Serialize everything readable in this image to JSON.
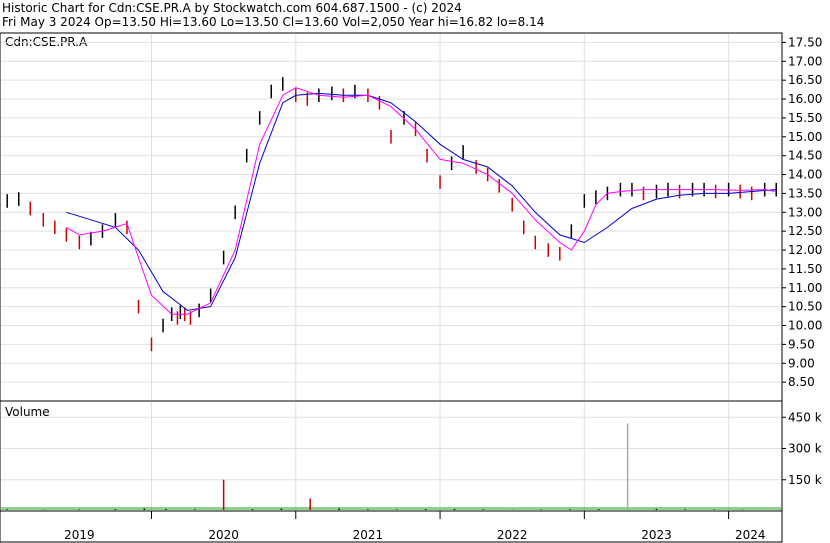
{
  "header": {
    "line1": "Historic Chart for Cdn:CSE.PR.A by Stockwatch.com 604.687.1500 - (c) 2024",
    "line2": "Fri May  3 2024   Op=13.50  Hi=13.60  Lo=13.50  Cl=13.60  Vol=2,050  Year hi=16.82  lo=8.14"
  },
  "colors": {
    "price": "#000000",
    "down_day": "#cc0000",
    "ma_short": "#ff00ff",
    "ma_long": "#0000cc",
    "volume": "#000000",
    "volume_up": "#009900",
    "volume_down": "#cc0000",
    "volume_spike": "#aaaaaa",
    "grid": "#e0e0e0",
    "panel_border": "#000000"
  },
  "chart_data": [
    {
      "type": "line",
      "title": "Cdn:CSE.PR.A",
      "ylim": [
        8.0,
        17.75
      ],
      "y_ticks": [
        "17.50",
        "17.00",
        "16.50",
        "16.00",
        "15.50",
        "15.00",
        "14.50",
        "14.00",
        "13.50",
        "13.00",
        "12.50",
        "12.00",
        "11.50",
        "11.00",
        "10.50",
        "10.00",
        "9.50",
        "9.00",
        "8.50"
      ],
      "xlim": [
        2018.95,
        2024.37
      ],
      "x_ticks": [
        "2019",
        "2020",
        "2021",
        "2022",
        "2023",
        "2024"
      ],
      "x_tick_pos": [
        2019.5,
        2020.5,
        2021.5,
        2022.5,
        2023.5,
        2024.15
      ],
      "grid": true,
      "series": [
        {
          "style": "daily-bars",
          "x": [
            2019.0,
            2019.08,
            2019.16,
            2019.25,
            2019.33,
            2019.41,
            2019.5,
            2019.58,
            2019.66,
            2019.75,
            2019.83,
            2019.91,
            2020.0,
            2020.08,
            2020.14,
            2020.18,
            2020.2,
            2020.23,
            2020.27,
            2020.33,
            2020.41,
            2020.5,
            2020.58,
            2020.66,
            2020.75,
            2020.83,
            2020.91,
            2021.0,
            2021.08,
            2021.16,
            2021.25,
            2021.33,
            2021.41,
            2021.5,
            2021.58,
            2021.66,
            2021.75,
            2021.83,
            2021.91,
            2022.0,
            2022.08,
            2022.16,
            2022.25,
            2022.33,
            2022.41,
            2022.5,
            2022.58,
            2022.66,
            2022.75,
            2022.83,
            2022.91,
            2023.0,
            2023.08,
            2023.16,
            2023.25,
            2023.33,
            2023.41,
            2023.5,
            2023.58,
            2023.66,
            2023.75,
            2023.83,
            2023.91,
            2024.0,
            2024.08,
            2024.16,
            2024.25,
            2024.33
          ],
          "values": [
            13.3,
            13.35,
            13.1,
            12.8,
            12.6,
            12.4,
            12.2,
            12.3,
            12.5,
            12.8,
            12.6,
            10.5,
            9.5,
            10.0,
            10.3,
            10.2,
            10.35,
            10.3,
            10.2,
            10.4,
            10.8,
            11.8,
            13.0,
            14.5,
            15.5,
            16.2,
            16.4,
            16.1,
            16.0,
            16.1,
            16.15,
            16.1,
            16.2,
            16.1,
            15.9,
            15.0,
            15.5,
            15.2,
            14.5,
            13.8,
            14.3,
            14.6,
            14.2,
            14.0,
            13.7,
            13.2,
            12.6,
            12.2,
            12.0,
            11.9,
            12.5,
            13.3,
            13.4,
            13.5,
            13.6,
            13.6,
            13.5,
            13.55,
            13.6,
            13.55,
            13.6,
            13.6,
            13.55,
            13.6,
            13.55,
            13.5,
            13.6,
            13.6
          ]
        },
        {
          "style": "moving-average-short",
          "x": [
            2019.41,
            2019.5,
            2019.66,
            2019.83,
            2019.91,
            2020.0,
            2020.14,
            2020.25,
            2020.41,
            2020.58,
            2020.75,
            2020.91,
            2021.0,
            2021.16,
            2021.33,
            2021.5,
            2021.66,
            2021.83,
            2022.0,
            2022.16,
            2022.33,
            2022.5,
            2022.66,
            2022.83,
            2022.91,
            2023.0,
            2023.08,
            2023.16,
            2023.25,
            2023.41,
            2023.58,
            2023.75,
            2023.91,
            2024.08,
            2024.25,
            2024.33
          ],
          "values": [
            12.6,
            12.4,
            12.5,
            12.7,
            11.8,
            10.8,
            10.3,
            10.3,
            10.6,
            12.0,
            14.8,
            16.1,
            16.3,
            16.1,
            16.05,
            16.1,
            15.8,
            15.2,
            14.4,
            14.3,
            14.0,
            13.5,
            12.8,
            12.2,
            12.0,
            12.5,
            13.2,
            13.5,
            13.55,
            13.6,
            13.6,
            13.6,
            13.6,
            13.58,
            13.6,
            13.55
          ]
        },
        {
          "style": "moving-average-long",
          "x": [
            2019.41,
            2019.58,
            2019.75,
            2019.91,
            2020.08,
            2020.25,
            2020.41,
            2020.58,
            2020.75,
            2020.91,
            2021.0,
            2021.16,
            2021.33,
            2021.5,
            2021.66,
            2021.83,
            2022.0,
            2022.16,
            2022.33,
            2022.5,
            2022.66,
            2022.83,
            2023.0,
            2023.16,
            2023.33,
            2023.5,
            2023.66,
            2023.83,
            2024.0,
            2024.16,
            2024.33
          ],
          "values": [
            13.0,
            12.8,
            12.6,
            12.0,
            10.9,
            10.4,
            10.5,
            11.8,
            14.3,
            15.9,
            16.1,
            16.15,
            16.1,
            16.1,
            15.9,
            15.4,
            14.8,
            14.4,
            14.2,
            13.7,
            13.0,
            12.4,
            12.2,
            12.6,
            13.1,
            13.35,
            13.45,
            13.5,
            13.5,
            13.55,
            13.6
          ]
        }
      ]
    },
    {
      "type": "bar",
      "title": "Volume",
      "y_ticks": [
        "450 k",
        "300 k",
        "150 k"
      ],
      "ylim": [
        0,
        480000
      ],
      "grid": true,
      "x": [
        2019.0,
        2019.25,
        2019.5,
        2019.75,
        2019.95,
        2020.1,
        2020.3,
        2020.5,
        2020.7,
        2020.9,
        2021.1,
        2021.3,
        2021.5,
        2021.7,
        2021.9,
        2022.1,
        2022.3,
        2022.5,
        2022.7,
        2022.9,
        2023.1,
        2023.3,
        2023.5,
        2023.7,
        2023.9,
        2024.1,
        2024.3
      ],
      "values": [
        8000,
        6000,
        7000,
        9000,
        12000,
        10000,
        8000,
        150000,
        9000,
        11000,
        60000,
        12000,
        8000,
        7000,
        9000,
        10000,
        8000,
        6000,
        7000,
        8000,
        9000,
        420000,
        10000,
        8000,
        7000,
        6000,
        5000
      ]
    }
  ]
}
